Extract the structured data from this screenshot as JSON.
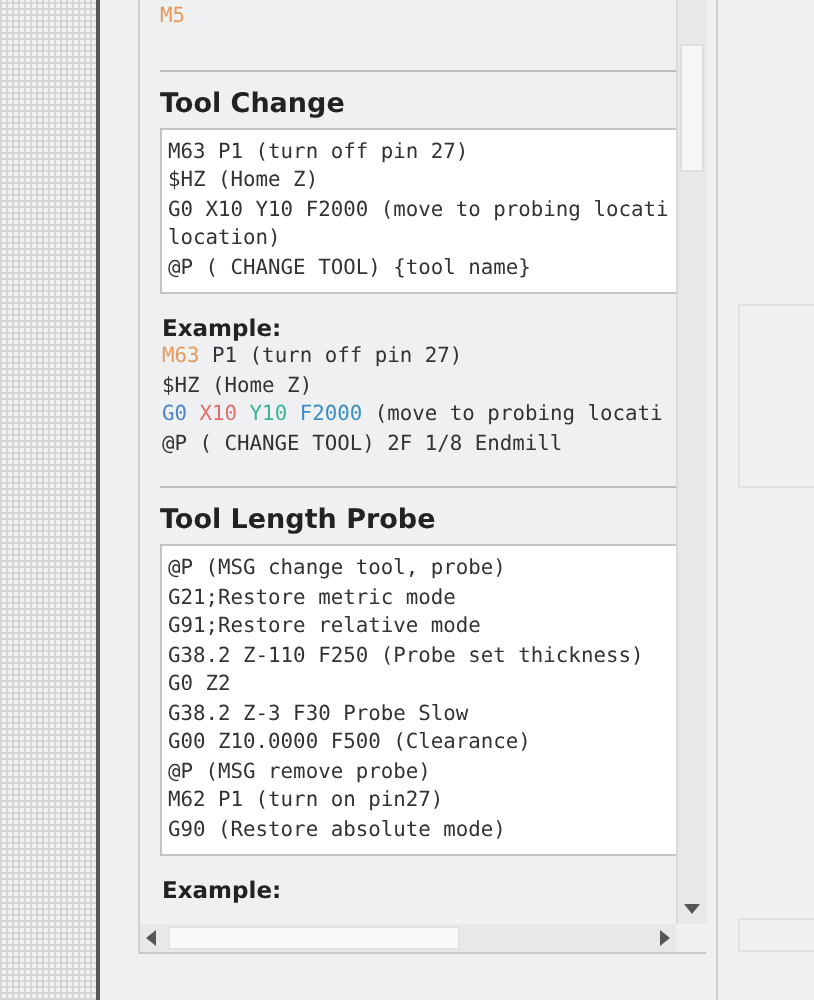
{
  "top_example": {
    "lines": [
      {
        "segments": [
          {
            "text": "M5",
            "color": "#e39a5a"
          }
        ]
      }
    ]
  },
  "sections": [
    {
      "title": "Tool Change",
      "code_lines": [
        "M63 P1 (turn off pin 27)",
        "$HZ (Home Z)",
        "G0 X10 Y10 F2000 (move to probing locati",
        "location)",
        "@P ( CHANGE TOOL) {tool name}"
      ],
      "example_label": "Example:",
      "example_lines": [
        {
          "segments": [
            {
              "text": "M63",
              "color": "#e39a5a"
            },
            {
              "text": " P1 (turn off pin 27)"
            }
          ]
        },
        {
          "segments": [
            {
              "text": "$HZ (Home Z)"
            }
          ]
        },
        {
          "segments": [
            {
              "text": "G0",
              "color": "#4a86c8"
            },
            {
              "text": " X10",
              "color": "#e07070"
            },
            {
              "text": " Y10",
              "color": "#3fb29c"
            },
            {
              "text": " F2000",
              "color": "#3a8fc0"
            },
            {
              "text": " (move to probing locati"
            }
          ]
        },
        {
          "segments": [
            {
              "text": "@P ( CHANGE TOOL) 2F 1/8 Endmill"
            }
          ]
        }
      ]
    },
    {
      "title": "Tool Length Probe",
      "code_lines": [
        "@P (MSG change tool, probe)",
        "G21;Restore metric mode",
        "G91;Restore relative mode",
        "G38.2 Z-110 F250 (Probe set thickness)",
        "G0 Z2",
        "G38.2 Z-3 F30 Probe Slow",
        "G00 Z10.0000 F500 (Clearance)",
        "@P (MSG remove probe)",
        "M62 P1 (turn on pin27)",
        "G90 (Restore absolute mode)"
      ],
      "example_label": "Example:"
    }
  ]
}
